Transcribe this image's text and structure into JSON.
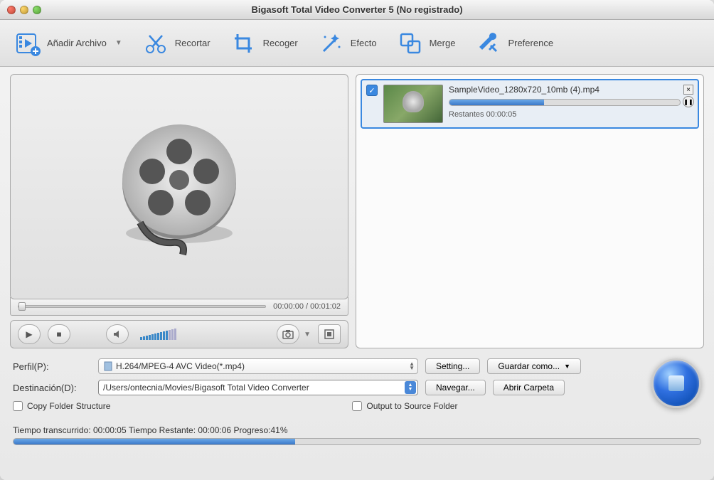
{
  "window": {
    "title": "Bigasoft Total Video Converter 5 (No registrado)"
  },
  "toolbar": {
    "add_file": "Añadir Archivo",
    "trim": "Recortar",
    "crop": "Recoger",
    "effect": "Efecto",
    "merge": "Merge",
    "preference": "Preference"
  },
  "preview": {
    "current_time": "00:00:00",
    "total_time": "00:01:02"
  },
  "queue": {
    "items": [
      {
        "checked": true,
        "filename": "SampleVideo_1280x720_10mb (4).mp4",
        "remaining_label": "Restantes",
        "remaining_time": "00:00:05",
        "progress_pct": 41
      }
    ]
  },
  "profile": {
    "label": "Perfil(P):",
    "value": "H.264/MPEG-4 AVC Video(*.mp4)",
    "setting_btn": "Setting...",
    "saveas_btn": "Guardar como..."
  },
  "destination": {
    "label": "Destinación(D):",
    "path": "/Users/ontecnia/Movies/Bigasoft Total Video Converter",
    "browse_btn": "Navegar...",
    "open_folder_btn": "Abrir Carpeta"
  },
  "options": {
    "copy_folder_structure": "Copy Folder Structure",
    "output_to_source": "Output to Source Folder"
  },
  "status": {
    "elapsed_label": "Tiempo transcurrido:",
    "elapsed": "00:00:05",
    "remaining_label": "Tiempo Restante:",
    "remaining": "00:00:06",
    "progress_label": "Progreso:",
    "progress_text": "41%",
    "progress_pct": 41
  }
}
